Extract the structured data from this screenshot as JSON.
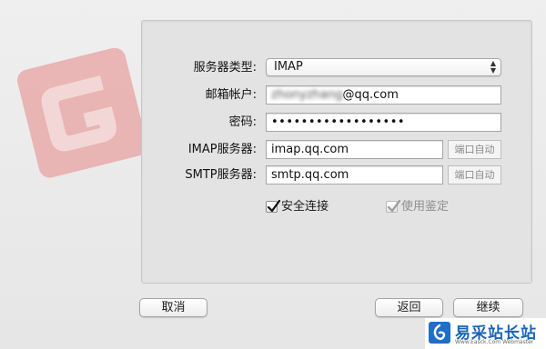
{
  "form": {
    "server_type_label": "服务器类型:",
    "server_type_value": "IMAP",
    "email_label": "邮箱帐户:",
    "email_blurred_part": "zhonyzhang",
    "email_domain": "@qq.com",
    "password_label": "密码:",
    "password_value": "••••••••••••••••••",
    "imap_label": "IMAP服务器:",
    "imap_value": "imap.qq.com",
    "smtp_label": "SMTP服务器:",
    "smtp_value": "smtp.qq.com",
    "port_auto_label": "端口自动"
  },
  "options": {
    "secure_label": "安全连接",
    "secure_checked": true,
    "auth_label": "使用鉴定",
    "auth_checked": true,
    "auth_disabled": true
  },
  "buttons": {
    "cancel": "取消",
    "back": "返回",
    "continue": "继续"
  },
  "watermark": {
    "text": "易采站长站",
    "subtext": "Www.Easck.Com Webmaster"
  },
  "colors": {
    "logo": "#e8a1a1",
    "watermark_blue": "#1b64b8"
  },
  "icons": {
    "logo": "app-logo-icon",
    "checkmark": "checkmark-icon",
    "select_arrows": "up-down-arrows-icon"
  }
}
